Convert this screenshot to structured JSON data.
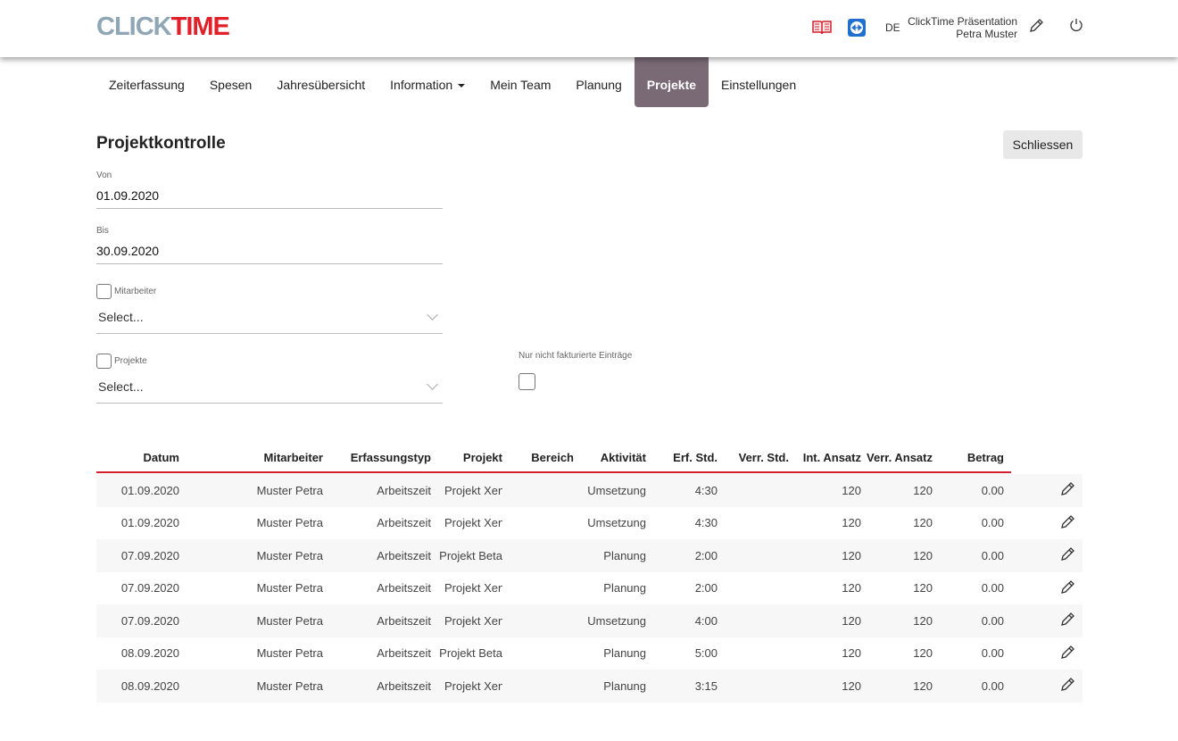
{
  "header": {
    "logo_a": "CLICK",
    "logo_b": "TIME",
    "language": "DE",
    "company": "ClickTime Präsentation",
    "user": "Petra Muster"
  },
  "nav": [
    {
      "label": "Zeiterfassung"
    },
    {
      "label": "Spesen"
    },
    {
      "label": "Jahresübersicht"
    },
    {
      "label": "Information"
    },
    {
      "label": "Mein Team"
    },
    {
      "label": "Planung"
    },
    {
      "label": "Projekte"
    },
    {
      "label": "Einstellungen"
    }
  ],
  "page": {
    "title": "Projektkontrolle",
    "close_label": "Schliessen"
  },
  "filters": {
    "von_label": "Von",
    "von_value": "01.09.2020",
    "bis_label": "Bis",
    "bis_value": "30.09.2020",
    "mitarbeiter_label": "Mitarbeiter",
    "mitarbeiter_value": "Select...",
    "projekte_label": "Projekte",
    "projekte_value": "Select...",
    "unbilled_label": "Nur nicht fakturierte Einträge"
  },
  "table": {
    "headers": [
      "Datum",
      "Mitarbeiter",
      "Erfassungstyp",
      "Projekt",
      "Bereich",
      "Aktivität",
      "Erf. Std.",
      "Verr. Std.",
      "Int. Ansatz",
      "Verr. Ansatz",
      "Betrag"
    ],
    "rows": [
      [
        "01.09.2020",
        "Muster Petra",
        "Arbeitszeit",
        "Projekt Xen...",
        "",
        "Umsetzung",
        "4:30",
        "",
        "120",
        "120",
        "0.00"
      ],
      [
        "01.09.2020",
        "Muster Petra",
        "Arbeitszeit",
        "Projekt Xen...",
        "",
        "Umsetzung",
        "4:30",
        "",
        "120",
        "120",
        "0.00"
      ],
      [
        "07.09.2020",
        "Muster Petra",
        "Arbeitszeit",
        "Projekt Beta",
        "",
        "Planung",
        "2:00",
        "",
        "120",
        "120",
        "0.00"
      ],
      [
        "07.09.2020",
        "Muster Petra",
        "Arbeitszeit",
        "Projekt Xen...",
        "",
        "Planung",
        "2:00",
        "",
        "120",
        "120",
        "0.00"
      ],
      [
        "07.09.2020",
        "Muster Petra",
        "Arbeitszeit",
        "Projekt Xen...",
        "",
        "Umsetzung",
        "4:00",
        "",
        "120",
        "120",
        "0.00"
      ],
      [
        "08.09.2020",
        "Muster Petra",
        "Arbeitszeit",
        "Projekt Beta",
        "",
        "Planung",
        "5:00",
        "",
        "120",
        "120",
        "0.00"
      ],
      [
        "08.09.2020",
        "Muster Petra",
        "Arbeitszeit",
        "Projekt Xen...",
        "",
        "Planung",
        "3:15",
        "",
        "120",
        "120",
        "0.00"
      ]
    ]
  }
}
